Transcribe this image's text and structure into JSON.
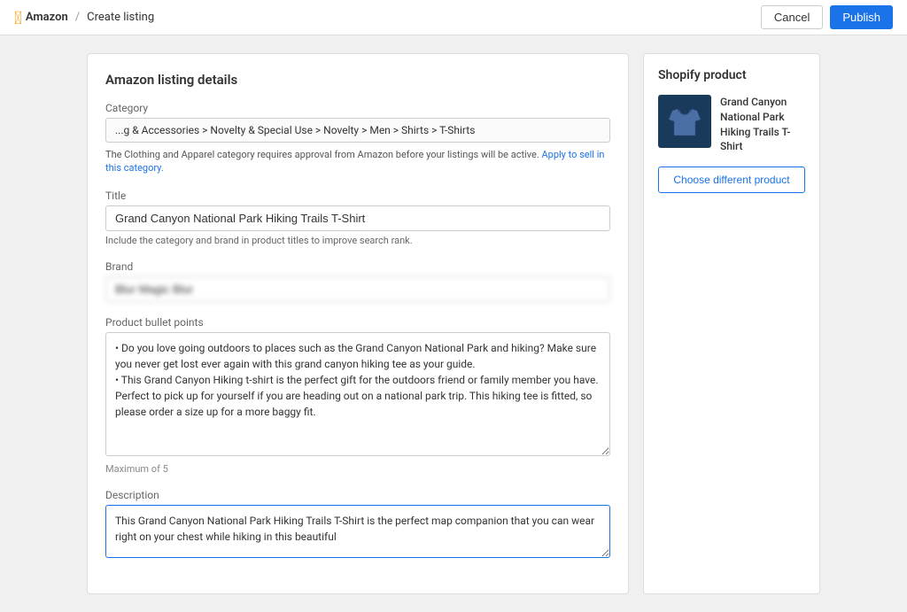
{
  "header": {
    "logo_text": "Amazon",
    "breadcrumb_sep": "/",
    "page_title": "Create listing",
    "cancel_label": "Cancel",
    "publish_label": "Publish"
  },
  "left_panel": {
    "section_title": "Amazon listing details",
    "category": {
      "label": "Category",
      "value": "...g & Accessories > Novelty & Special Use > Novelty > Men > Shirts > T-Shirts",
      "note": "The Clothing and Apparel category requires approval from Amazon before your listings will be active.",
      "link_text": "Apply to sell in this category."
    },
    "title": {
      "label": "Title",
      "value": "Grand Canyon National Park Hiking Trails T-Shirt",
      "hint": "Include the category and brand in product titles to improve search rank."
    },
    "brand": {
      "label": "Brand",
      "placeholder": "Blur Magic Blur"
    },
    "bullet_points": {
      "label": "Product bullet points",
      "value": "• Do you love going outdoors to places such as the Grand Canyon National Park and hiking? Make sure you never get lost ever again with this grand canyon hiking tee as your guide.\n• This Grand Canyon Hiking t-shirt is the perfect gift for the outdoors friend or family member you have. Perfect to pick up for yourself if you are heading out on a national park trip. This hiking tee is fitted, so please order a size up for a more baggy fit.",
      "max_label": "Maximum of 5"
    },
    "description": {
      "label": "Description",
      "value": "This Grand Canyon National Park Hiking Trails T-Shirt is the perfect map companion that you can wear right on your chest while hiking in this beautiful"
    }
  },
  "right_panel": {
    "title": "Shopify product",
    "product_name": "Grand Canyon National Park Hiking Trails T-Shirt",
    "choose_label": "Choose different product"
  }
}
